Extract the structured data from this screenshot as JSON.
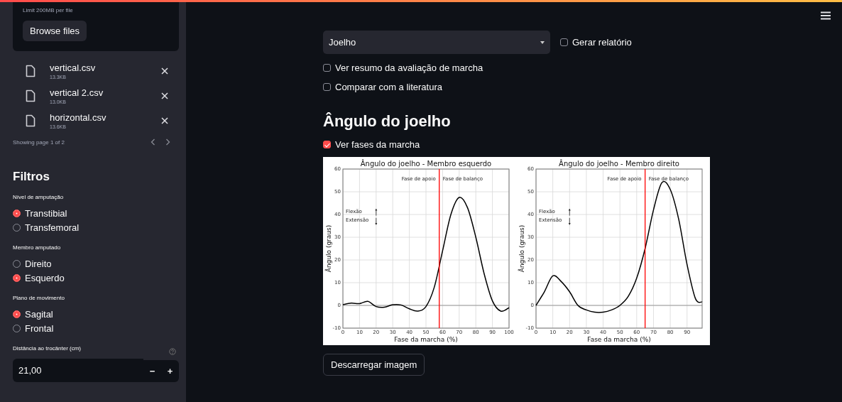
{
  "uploader": {
    "limit": "Limit 200MB per file",
    "button": "Browse files"
  },
  "files": [
    {
      "name": "vertical.csv",
      "size": "13.3KB"
    },
    {
      "name": "vertical 2.csv",
      "size": "13.0KB"
    },
    {
      "name": "horizontal.csv",
      "size": "13.6KB"
    }
  ],
  "pager": {
    "text": "Showing page 1 of 2"
  },
  "filters": {
    "title": "Filtros",
    "groups": [
      {
        "label": "Nível de amputação",
        "options": [
          {
            "label": "Transtibial",
            "selected": true
          },
          {
            "label": "Transfemoral",
            "selected": false
          }
        ]
      },
      {
        "label": "Membro amputado",
        "options": [
          {
            "label": "Direito",
            "selected": false
          },
          {
            "label": "Esquerdo",
            "selected": true
          }
        ]
      },
      {
        "label": "Plano de movimento",
        "options": [
          {
            "label": "Sagital",
            "selected": true
          },
          {
            "label": "Frontal",
            "selected": false
          }
        ]
      }
    ],
    "number": {
      "label": "Distância ao trocânter (cm)",
      "value": "21,00",
      "minus": "−",
      "plus": "+"
    }
  },
  "select": {
    "value": "Joelho"
  },
  "report_checkbox": {
    "label": "Gerar relatório",
    "checked": false
  },
  "options": [
    {
      "label": "Ver resumo da avaliação de marcha",
      "checked": false
    },
    {
      "label": "Comparar com a literatura",
      "checked": false
    }
  ],
  "heading": "Ângulo do joelho",
  "phases_checkbox": {
    "label": "Ver fases da marcha",
    "checked": true
  },
  "charts": [
    {
      "chart_data": {
        "type": "line",
        "title": "Ângulo do joelho - Membro esquerdo",
        "xlabel": "Fase da marcha (%)",
        "ylabel": "Ângulo (graus)",
        "x": [
          0,
          5,
          10,
          15,
          20,
          25,
          30,
          35,
          40,
          45,
          50,
          55,
          60,
          65,
          70,
          75,
          80,
          85,
          90,
          95,
          100
        ],
        "series": [
          {
            "color": "#000000",
            "values": [
              0.3,
              1,
              0.8,
              1.8,
              -0.5,
              -0.8,
              0.3,
              0.2,
              -1.5,
              -2.5,
              -0.5,
              8,
              24,
              40,
              47.5,
              43,
              30,
              14,
              2,
              -2.5,
              -1
            ]
          }
        ],
        "xlim": [
          0,
          100
        ],
        "ylim": [
          -10,
          60
        ],
        "xticks": [
          0,
          10,
          20,
          30,
          40,
          50,
          60,
          70,
          80,
          90,
          100
        ],
        "yticks": [
          -10,
          0,
          10,
          20,
          30,
          40,
          50,
          60
        ],
        "grid": true,
        "ref_lines": [
          {
            "axis": "x",
            "value": 58,
            "color": "#ff0000"
          }
        ],
        "annotations": [
          "Fase de apoio",
          "Fase de balanço",
          "Flexão",
          "Extensão"
        ]
      }
    },
    {
      "chart_data": {
        "type": "line",
        "title": "Ângulo do joelho - Membro direito",
        "xlabel": "Fase da marcha (%)",
        "ylabel": "Ângulo (graus)",
        "x": [
          0,
          5,
          10,
          15,
          20,
          25,
          30,
          35,
          40,
          45,
          50,
          55,
          60,
          65,
          70,
          75,
          80,
          85,
          90,
          95,
          99
        ],
        "series": [
          {
            "color": "#000000",
            "values": [
              0,
              6,
              13,
              10.5,
              6,
              0,
              -2,
              -3,
              -3,
              -2,
              0,
              4,
              12,
              25,
              42,
              54,
              51,
              38,
              18,
              3,
              1.5
            ]
          }
        ],
        "xlim": [
          0,
          99
        ],
        "ylim": [
          -10,
          60
        ],
        "xticks": [
          0,
          10,
          20,
          30,
          40,
          50,
          60,
          70,
          80,
          90
        ],
        "yticks": [
          -10,
          0,
          10,
          20,
          30,
          40,
          50,
          60
        ],
        "grid": true,
        "ref_lines": [
          {
            "axis": "x",
            "value": 65,
            "color": "#ff0000"
          }
        ],
        "annotations": [
          "Fase de apoio",
          "Fase de balanço",
          "Flexão",
          "Extensão"
        ]
      }
    }
  ],
  "download_button": "Descarregar imagem"
}
